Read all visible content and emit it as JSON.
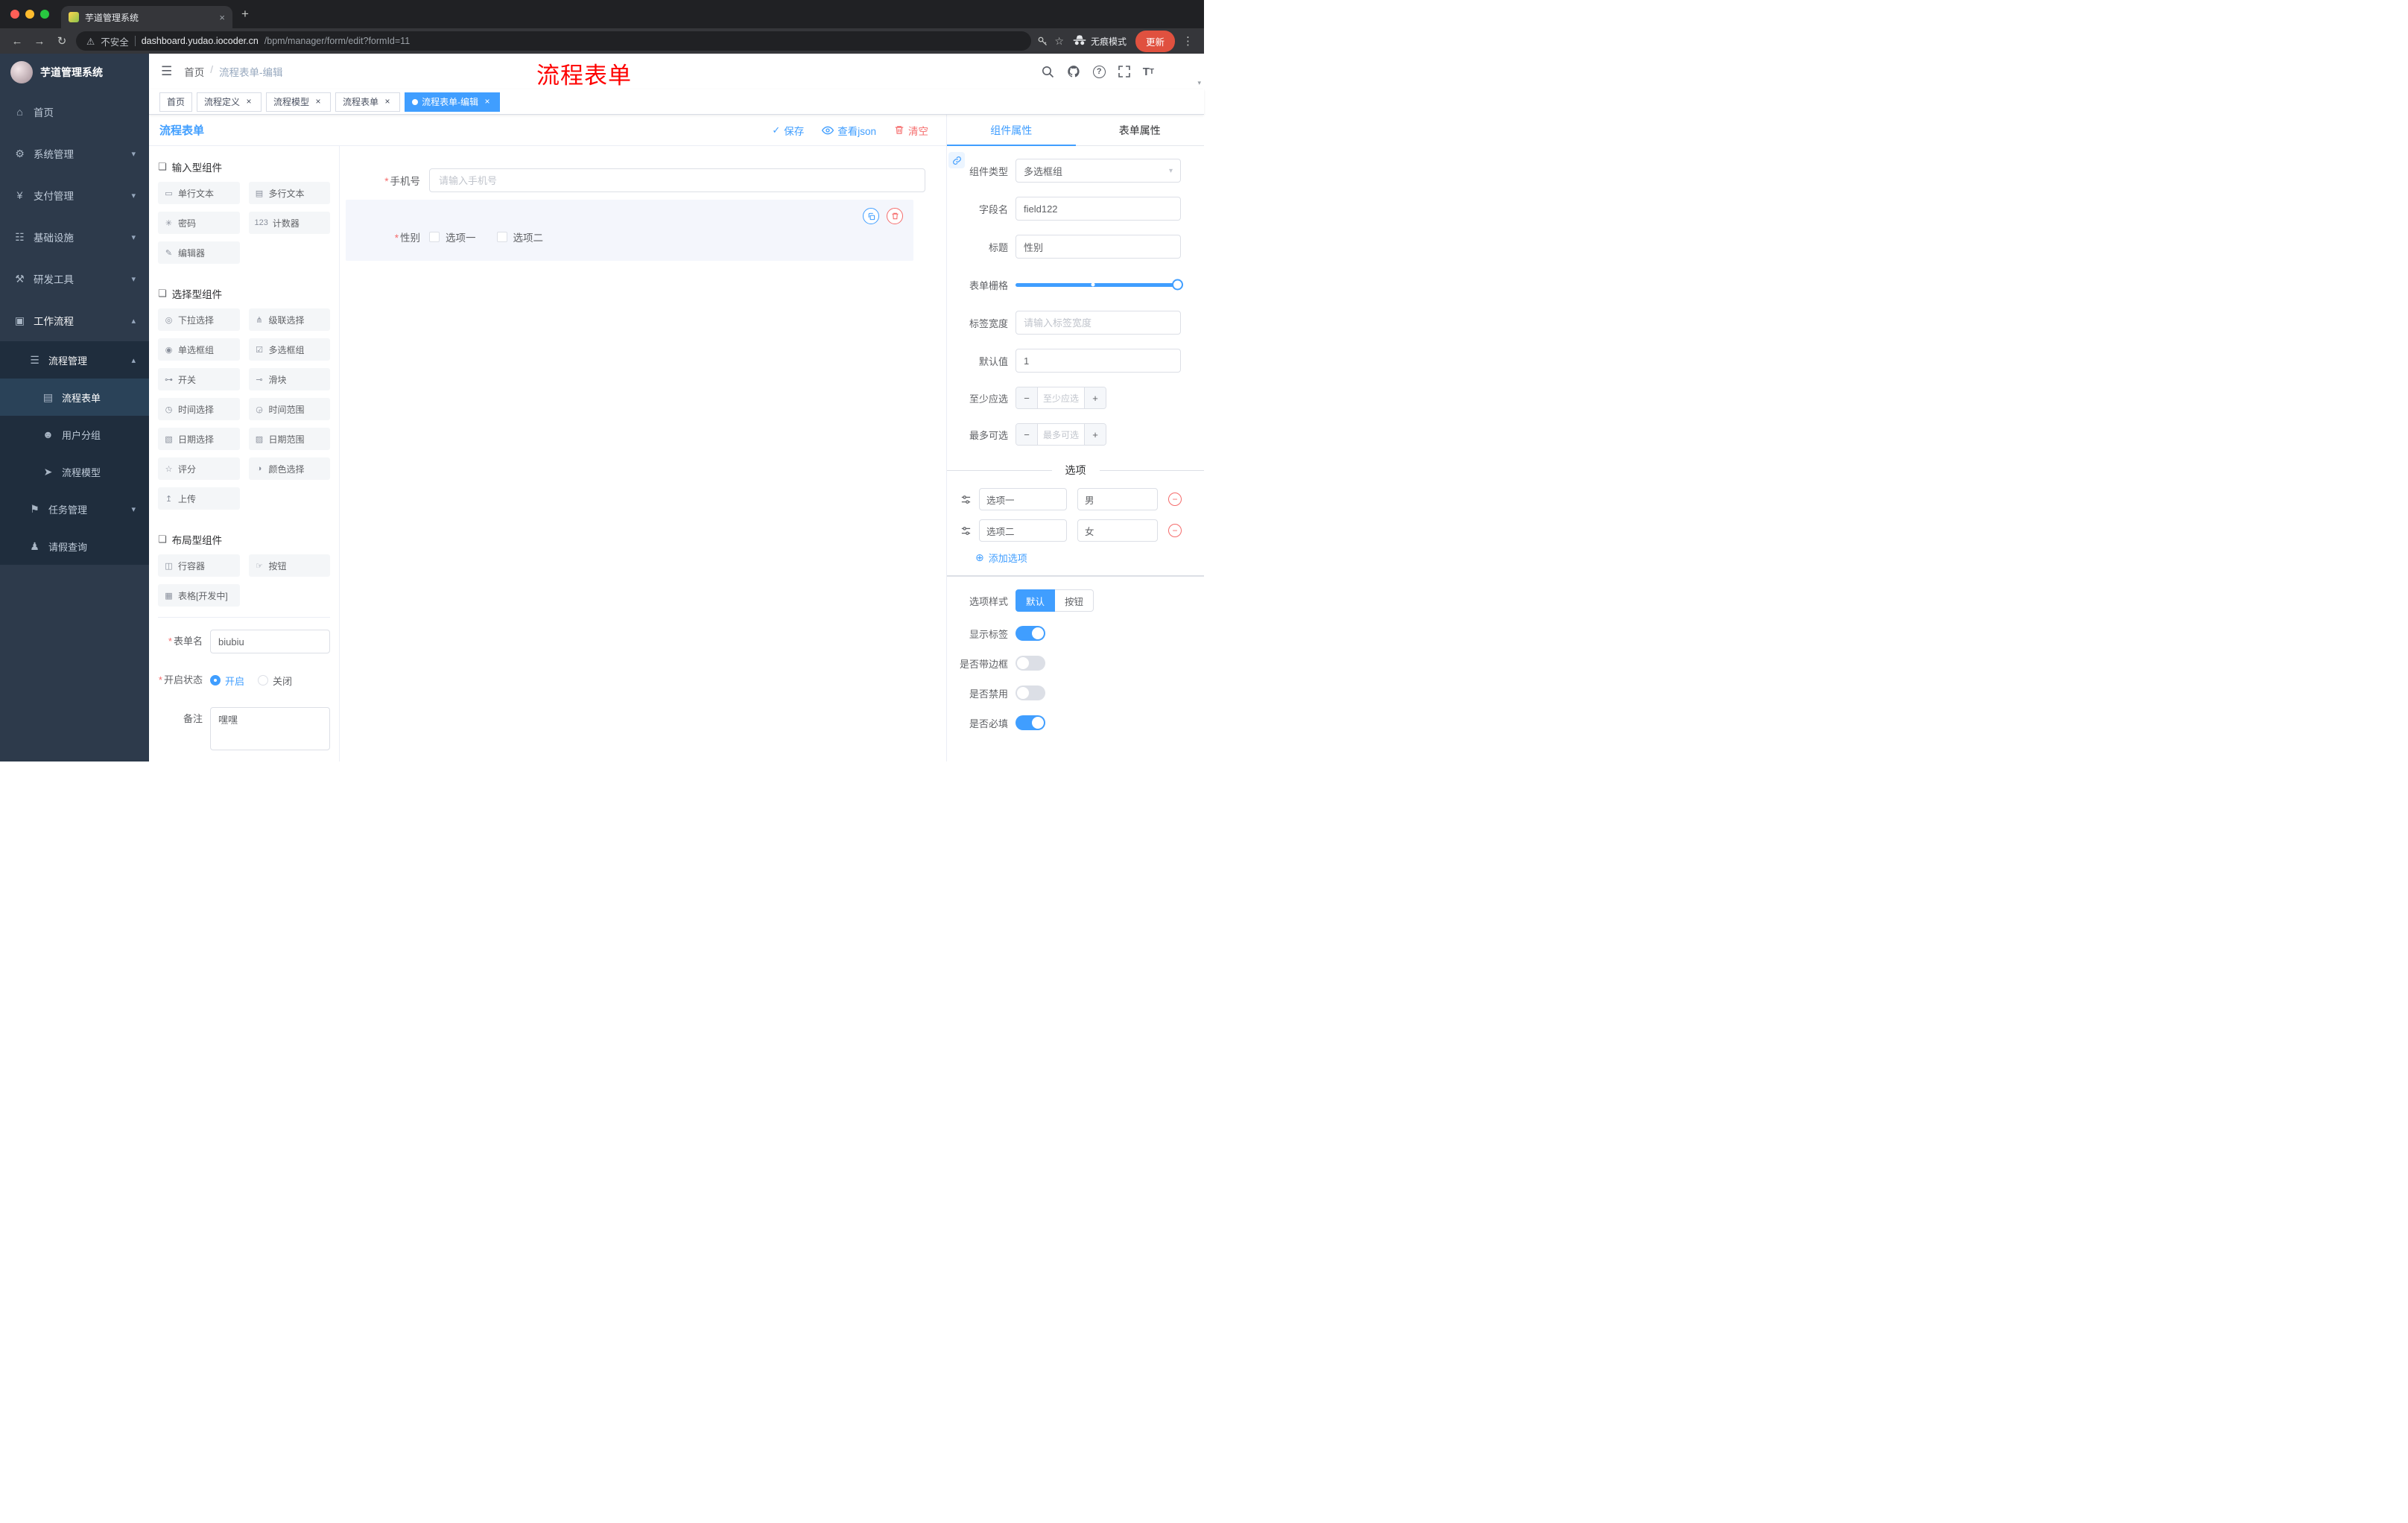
{
  "colors": {
    "primary": "#409EFF",
    "danger": "#F56C6C",
    "annotation_red": "#FE0100",
    "sidebar_bg": "#2D3A4B",
    "submenu_bg": "#1F2D3D",
    "active_tag_bg": "#409EFF",
    "update_button_bg": "#E0513F",
    "selected_widget_bg": "#F4F6FC"
  },
  "icons": {
    "home": "⌂",
    "gear": "⚙",
    "yen": "¥",
    "infra": "☷",
    "tools": "⚒",
    "workflow": "▣",
    "process-list": "☰",
    "form-doc": "▤",
    "user-group": "☻",
    "process-model": "➤",
    "task": "⚑",
    "leave-query": "♟",
    "chevron-down": "▾",
    "chevron-up": "▴",
    "caret-down": "▾",
    "hamburger": "☰",
    "group": "❏",
    "single-line": "▭",
    "textarea": "▤",
    "password": "✳",
    "counter": "123",
    "editor": "✎",
    "select": "◎",
    "cascader": "⋔",
    "radio-group": "◉",
    "checkbox-group": "☑",
    "switch": "⊶",
    "slider": "⊸",
    "time": "◷",
    "time-range": "◶",
    "date": "▧",
    "date-range": "▨",
    "rate": "☆",
    "color": "◑",
    "upload": "↥",
    "row": "◫",
    "button": "☞",
    "table": "▦",
    "plus-circle": "⊕",
    "check": "✓",
    "warning": "⚠",
    "help": "?",
    "dot": "●",
    "close": "×",
    "minus": "−",
    "plus": "+",
    "kebab": "⋮",
    "star": "☆",
    "back": "←",
    "forward": "→",
    "reload": "↻",
    "fontsize": "T"
  },
  "browser": {
    "tab_title": "芋道管理系统",
    "security_text": "不安全",
    "url_domain": "dashboard.yudao.iocoder.cn",
    "url_path": "/bpm/manager/form/edit?formId=11",
    "incognito_label": "无痕模式",
    "update_label": "更新"
  },
  "app_header": {
    "breadcrumb_root": "首页",
    "breadcrumb_sep": "/",
    "breadcrumb_current": "流程表单-编辑",
    "annotation": "流程表单"
  },
  "tags": [
    {
      "label": "首页"
    },
    {
      "label": "流程定义"
    },
    {
      "label": "流程模型"
    },
    {
      "label": "流程表单"
    },
    {
      "label": "流程表单-编辑"
    }
  ],
  "sidebar": {
    "logo_title": "芋道管理系统",
    "menu": [
      {
        "label": "首页",
        "icon": "home"
      },
      {
        "label": "系统管理",
        "icon": "gear"
      },
      {
        "label": "支付管理",
        "icon": "yen"
      },
      {
        "label": "基础设施",
        "icon": "infra"
      },
      {
        "label": "研发工具",
        "icon": "tools"
      },
      {
        "label": "工作流程",
        "icon": "workflow"
      },
      {
        "label": "流程管理",
        "icon": "process-list"
      },
      {
        "label": "流程表单",
        "icon": "form-doc"
      },
      {
        "label": "用户分组",
        "icon": "user-group"
      },
      {
        "label": "流程模型",
        "icon": "process-model"
      },
      {
        "label": "任务管理",
        "icon": "task"
      },
      {
        "label": "请假查询",
        "icon": "leave-query"
      }
    ]
  },
  "builder": {
    "title": "流程表单",
    "save_label": "保存",
    "view_json_label": "查看json",
    "clear_label": "清空",
    "groups": [
      {
        "title": "输入型组件",
        "items": [
          {
            "label": "单行文本",
            "icon": "single-line"
          },
          {
            "label": "多行文本",
            "icon": "textarea"
          },
          {
            "label": "密码",
            "icon": "password"
          },
          {
            "label": "计数器",
            "icon": "counter"
          },
          {
            "label": "编辑器",
            "icon": "editor"
          }
        ]
      },
      {
        "title": "选择型组件",
        "items": [
          {
            "label": "下拉选择",
            "icon": "select"
          },
          {
            "label": "级联选择",
            "icon": "cascader"
          },
          {
            "label": "单选框组",
            "icon": "radio-group"
          },
          {
            "label": "多选框组",
            "icon": "checkbox-group"
          },
          {
            "label": "开关",
            "icon": "switch"
          },
          {
            "label": "滑块",
            "icon": "slider"
          },
          {
            "label": "时间选择",
            "icon": "time"
          },
          {
            "label": "时间范围",
            "icon": "time-range"
          },
          {
            "label": "日期选择",
            "icon": "date"
          },
          {
            "label": "日期范围",
            "icon": "date-range"
          },
          {
            "label": "评分",
            "icon": "rate"
          },
          {
            "label": "颜色选择",
            "icon": "color"
          },
          {
            "label": "上传",
            "icon": "upload"
          }
        ]
      },
      {
        "title": "布局型组件",
        "items": [
          {
            "label": "行容器",
            "icon": "row"
          },
          {
            "label": "按钮",
            "icon": "button"
          },
          {
            "label": "表格[开发中]",
            "icon": "table"
          }
        ]
      }
    ],
    "meta": {
      "required_marker": "*",
      "name_label": "表单名",
      "name_value": "biubiu",
      "status_label": "开启状态",
      "status_on": "开启",
      "status_off": "关闭",
      "remark_label": "备注",
      "remark_value": "嘿嘿"
    }
  },
  "canvas": {
    "required_marker": "*",
    "phone_label": "手机号",
    "phone_placeholder": "请输入手机号",
    "gender_label": "性别",
    "gender_option1": "选项一",
    "gender_option2": "选项二"
  },
  "props": {
    "tab_component": "组件属性",
    "tab_form": "表单属性",
    "type_label": "组件类型",
    "type_value": "多选框组",
    "field_label": "字段名",
    "field_value": "field122",
    "title_label": "标题",
    "title_value": "性别",
    "grid_label": "表单栅格",
    "label_width_label": "标签宽度",
    "label_width_placeholder": "请输入标签宽度",
    "default_label": "默认值",
    "default_value": "1",
    "min_label": "至少应选",
    "min_placeholder": "至少应选",
    "max_label": "最多可选",
    "max_placeholder": "最多可选",
    "options_title": "选项",
    "option_rows": [
      {
        "name": "选项一",
        "value": "男"
      },
      {
        "name": "选项二",
        "value": "女"
      }
    ],
    "add_option_label": "添加选项",
    "style_label": "选项样式",
    "style_default": "默认",
    "style_button": "按钮",
    "switch_show_label": "显示标签",
    "switch_border_label": "是否带边框",
    "switch_disabled_label": "是否禁用",
    "switch_required_label": "是否必填",
    "switch_states": {
      "show_label": true,
      "border": false,
      "disabled": false,
      "required": true
    }
  }
}
